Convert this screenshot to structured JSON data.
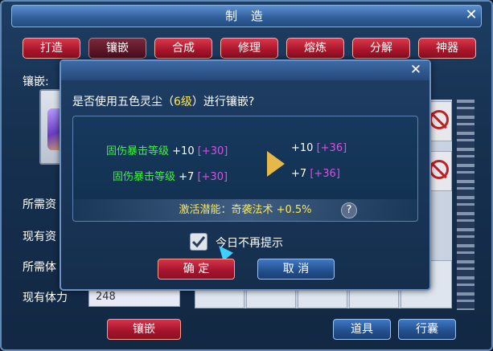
{
  "window": {
    "title": "制 造",
    "close_label": "✕"
  },
  "tabs": [
    {
      "label": "打造"
    },
    {
      "label": "镶嵌"
    },
    {
      "label": "合成"
    },
    {
      "label": "修理"
    },
    {
      "label": "熔炼"
    },
    {
      "label": "分解"
    },
    {
      "label": "神器"
    }
  ],
  "left_panel": {
    "inlay_label": "镶嵌:",
    "required_a": "所需资",
    "current_a": "现有资",
    "required_b": "所需体",
    "current_stamina_label": "现有体力",
    "current_stamina_value": "248"
  },
  "buttons": {
    "inlay": "镶嵌",
    "items": "道具",
    "bag": "行囊"
  },
  "dialog": {
    "close_label": "✕",
    "question_prefix": "是否使用五色灵尘（",
    "question_level": "6级",
    "question_suffix": "）进行镶嵌?",
    "stats": [
      {
        "name": "固伤暴击等级",
        "current": "+10",
        "current_bonus": "[+30]",
        "new": "+10",
        "new_bonus": "[+36]"
      },
      {
        "name": "固伤暴击等级",
        "current": "+7",
        "current_bonus": "[+30]",
        "new": "+7",
        "new_bonus": "[+36]"
      }
    ],
    "potential": "激活潜能：奇袭法术 +0.5%",
    "help_label": "?",
    "checkbox_label": "今日不再提示",
    "checkbox_checked": true,
    "confirm": "确 定",
    "cancel": "取 消"
  },
  "icons": [
    "close-icon",
    "check-icon",
    "arrow-right-icon",
    "help-icon",
    "banned-icon",
    "cursor-icon"
  ]
}
